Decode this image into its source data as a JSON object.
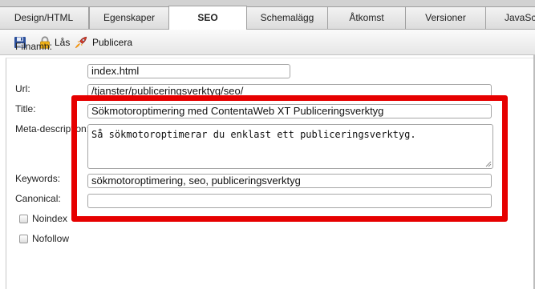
{
  "tabs": [
    {
      "label": "Design/HTML"
    },
    {
      "label": "Egenskaper"
    },
    {
      "label": "SEO",
      "active": true
    },
    {
      "label": "Schemalägg"
    },
    {
      "label": "Åtkomst"
    },
    {
      "label": "Versioner"
    },
    {
      "label": "JavaScri"
    }
  ],
  "toolbar": {
    "save_icon": "save-disk-icon",
    "lock_icon": "padlock-icon",
    "lock_label": "Lås",
    "publish_icon": "rocket-icon",
    "publish_label": "Publicera"
  },
  "form": {
    "filename_label": "Filnamn:",
    "filename_value": "index.html",
    "url_label": "Url:",
    "url_value": "/tjanster/publiceringsverktyg/seo/",
    "title_label": "Title:",
    "title_value": "Sökmotoroptimering med ContentaWeb XT Publiceringsverktyg",
    "meta_label": "Meta-description:",
    "meta_value": "Så sökmotoroptimerar du enklast ett publiceringsverktyg.",
    "keywords_label": "Keywords:",
    "keywords_value": "sökmotoroptimering, seo, publiceringsverktyg",
    "canonical_label": "Canonical:",
    "canonical_value": "",
    "noindex_label": "Noindex",
    "noindex_checked": false,
    "nofollow_label": "Nofollow",
    "nofollow_checked": false
  },
  "colors": {
    "highlight": "#e60000",
    "tab_bar": "#d2d2d2"
  }
}
